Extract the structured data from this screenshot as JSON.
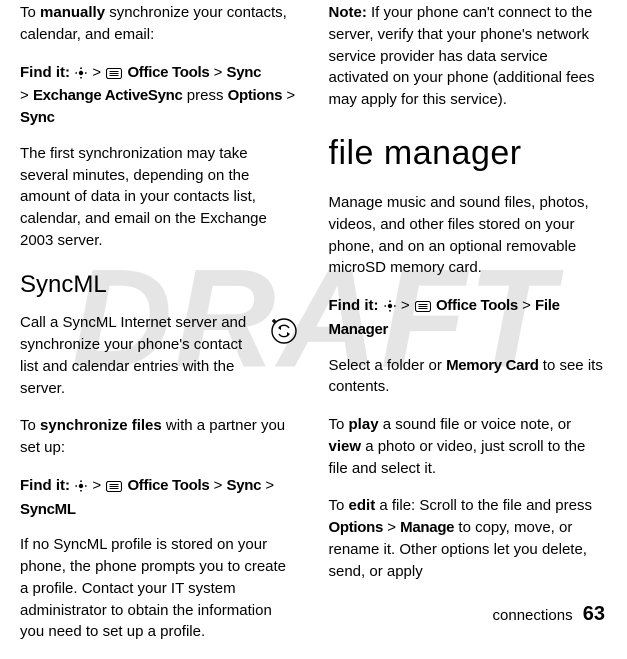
{
  "watermark": "DRAFT",
  "left": {
    "p1_pre": "To ",
    "p1_b": "manually",
    "p1_post": " synchronize your contacts, calendar, and email:",
    "find1_label": "Find it:",
    "find1_gt1": ">",
    "find1_officetools": "Office Tools",
    "find1_gt2": ">",
    "find1_sync": "Sync",
    "find1_gt3": ">",
    "find1_exchange": "Exchange ActiveSync",
    "find1_press": " press ",
    "find1_options": "Options",
    "find1_gt4": ">",
    "find1_sync2": "Sync",
    "p2": "The first synchronization may take several minutes, depending on the amount of data in your contacts list, calendar, and email on the Exchange 2003 server.",
    "h_syncml": "SyncML",
    "p3": "Call a SyncML Internet server and synchronize your phone's contact list and calendar entries with the server.",
    "p4_pre": "To ",
    "p4_b": "synchronize files",
    "p4_post": " with a partner you set up:",
    "find2_label": "Find it:",
    "find2_gt1": ">",
    "find2_officetools": "Office Tools",
    "find2_gt2": ">",
    "find2_sync": "Sync",
    "find2_gt3": ">",
    "find2_syncml": "SyncML",
    "p5": "If no SyncML profile is stored on your phone, the phone prompts you to create a profile. Contact your IT system administrator to obtain the information you need to set up a profile."
  },
  "right": {
    "p1_b": "Note:",
    "p1_post": " If your phone can't connect to the server, verify that your phone's network service provider has data service activated on your phone (additional fees may apply for this service).",
    "h_fm": "file manager",
    "p2": "Manage music and sound files, photos, videos, and other files stored on your phone, and on an optional removable microSD memory card.",
    "find_label": "Find it:",
    "find_gt1": ">",
    "find_officetools": "Office Tools",
    "find_gt2": ">",
    "find_fm": "File Manager",
    "p3_pre": "Select a folder or ",
    "p3_mem": "Memory Card",
    "p3_post": " to see its contents.",
    "p4_pre": "To ",
    "p4_b1": "play",
    "p4_mid": " a sound file or voice note, or ",
    "p4_b2": "view",
    "p4_post": " a photo or video, just scroll to the file and select it.",
    "p5_pre": "To ",
    "p5_b": "edit",
    "p5_mid": " a file: Scroll to the file and press ",
    "p5_opt": "Options",
    "p5_gt": ">",
    "p5_man": "Manage",
    "p5_post": " to copy, move, or rename it. Other options let you delete, send, or apply"
  },
  "footer": {
    "section": "connections",
    "page": "63"
  },
  "icons": {
    "center_key": "center-key-icon",
    "menu_key": "menu-key-icon",
    "sync": "sync-icon"
  }
}
